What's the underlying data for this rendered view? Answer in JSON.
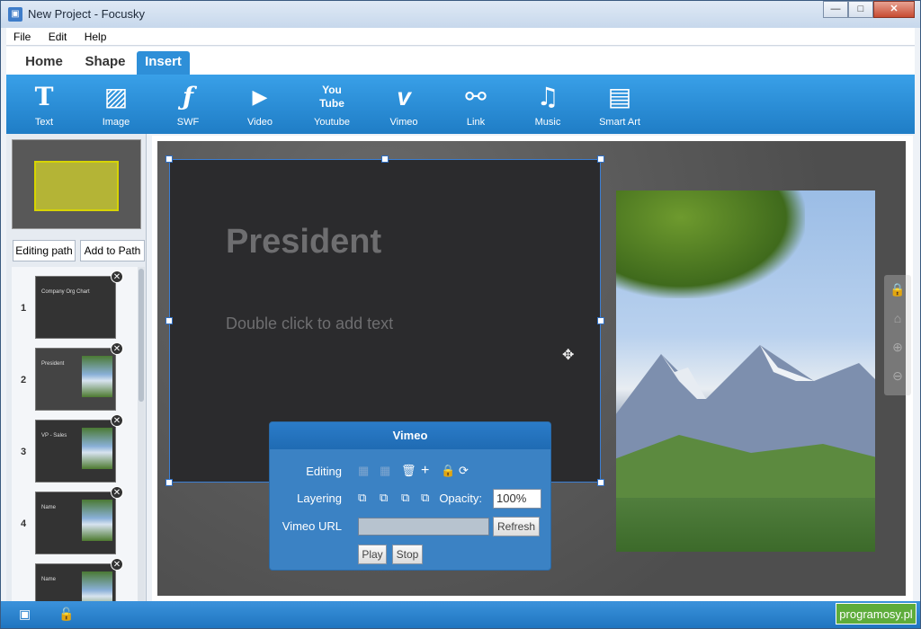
{
  "window": {
    "title": "New Project - Focusky"
  },
  "window_controls": {
    "minimize": "—",
    "maximize": "□",
    "close": "✕"
  },
  "menu": {
    "items": [
      "File",
      "Edit",
      "Help"
    ]
  },
  "tabs": [
    {
      "label": "Home",
      "active": false
    },
    {
      "label": "Shape",
      "active": false
    },
    {
      "label": "Insert",
      "active": true
    }
  ],
  "ribbon": {
    "items": [
      {
        "label": "Text",
        "icon": "text-icon",
        "glyph": "T"
      },
      {
        "label": "Image",
        "icon": "image-icon",
        "glyph": "▨"
      },
      {
        "label": "SWF",
        "icon": "swf-icon",
        "glyph": "ƒ"
      },
      {
        "label": "Video",
        "icon": "video-icon",
        "glyph": "▶"
      },
      {
        "label": "Youtube",
        "icon": "youtube-icon",
        "glyph": "You\nTube"
      },
      {
        "label": "Vimeo",
        "icon": "vimeo-icon",
        "glyph": "v"
      },
      {
        "label": "Link",
        "icon": "link-icon",
        "glyph": "⚯"
      },
      {
        "label": "Music",
        "icon": "music-icon",
        "glyph": "♫"
      },
      {
        "label": "Smart Art",
        "icon": "smart-art-icon",
        "glyph": "▤"
      }
    ]
  },
  "sidebar": {
    "editing_path_label": "Editing path",
    "add_to_path_label": "Add to Path",
    "slides": [
      {
        "number": "1",
        "text": "Company Org Chart"
      },
      {
        "number": "2",
        "text": "President"
      },
      {
        "number": "3",
        "text": "VP - Sales"
      },
      {
        "number": "4",
        "text": "Name"
      },
      {
        "number": "",
        "text": "Name"
      }
    ]
  },
  "canvas": {
    "slide_title": "President",
    "slide_subtitle": "Double click to add text"
  },
  "vimeo_panel": {
    "title": "Vimeo",
    "editing_label": "Editing",
    "layering_label": "Layering",
    "opacity_label": "Opacity:",
    "opacity_value": "100%",
    "url_label": "Vimeo URL",
    "url_value": "",
    "refresh_label": "Refresh",
    "play_label": "Play",
    "stop_label": "Stop"
  },
  "statusbar": {
    "watermark": "programosy.pl"
  }
}
